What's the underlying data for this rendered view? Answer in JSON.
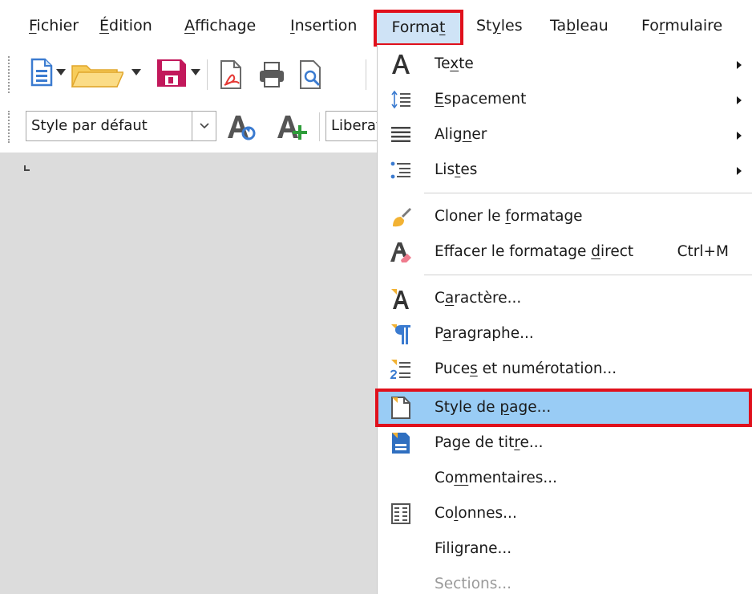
{
  "menubar": {
    "items": [
      {
        "pre": "",
        "u": "F",
        "post": "ichier"
      },
      {
        "pre": "",
        "u": "É",
        "post": "dition"
      },
      {
        "pre": "",
        "u": "A",
        "post": "ffichage"
      },
      {
        "pre": "",
        "u": "I",
        "post": "nsertion"
      },
      {
        "pre": "Forma",
        "u": "t",
        "post": ""
      },
      {
        "pre": "St",
        "u": "y",
        "post": "les"
      },
      {
        "pre": "Ta",
        "u": "b",
        "post": "leau"
      },
      {
        "pre": "Fo",
        "u": "r",
        "post": "mulaire"
      }
    ]
  },
  "toolbar": {
    "paragraph_style": "Style par défaut",
    "font_name": "Liberation Serif"
  },
  "colors": {
    "highlight": "#99ccf5",
    "annotation_red": "#e0101c",
    "menu_active": "#cfe3f6",
    "doc_background": "#dcdcdc"
  },
  "format_menu": {
    "items": [
      {
        "icon": "text-a-icon",
        "pre": "Te",
        "u": "x",
        "post": "te",
        "submenu": true
      },
      {
        "icon": "line-spacing-icon",
        "pre": "",
        "u": "E",
        "post": "spacement",
        "submenu": true
      },
      {
        "icon": "align-icon",
        "pre": "Alig",
        "u": "n",
        "post": "er",
        "submenu": true
      },
      {
        "icon": "list-icon",
        "pre": "Lis",
        "u": "t",
        "post": "es",
        "submenu": true
      },
      {
        "icon": "clone-formatting-icon",
        "pre": "Cloner le ",
        "u": "f",
        "post": "ormatage"
      },
      {
        "icon": "clear-formatting-icon",
        "pre": "Effacer le formatage ",
        "u": "d",
        "post": "irect",
        "shortcut": "Ctrl+M"
      },
      {
        "icon": "character-icon",
        "pre": "C",
        "u": "a",
        "post": "ractère..."
      },
      {
        "icon": "paragraph-icon",
        "pre": "P",
        "u": "a",
        "post": "ragraphe..."
      },
      {
        "icon": "bullets-numbering-icon",
        "pre": "Puce",
        "u": "s",
        "post": " et numérotation..."
      },
      {
        "icon": "page-style-icon",
        "pre": "Style de ",
        "u": "p",
        "post": "age...",
        "highlighted": true
      },
      {
        "icon": "title-page-icon",
        "pre": "Page de tit",
        "u": "r",
        "post": "e..."
      },
      {
        "icon": "",
        "pre": "Co",
        "u": "m",
        "post": "mentaires..."
      },
      {
        "icon": "columns-icon",
        "pre": "Co",
        "u": "l",
        "post": "onnes..."
      },
      {
        "icon": "",
        "pre": "Filigrane...",
        "u": "",
        "post": ""
      },
      {
        "icon": "",
        "pre": "Sections...",
        "u": "",
        "post": "",
        "disabled": true
      }
    ]
  }
}
